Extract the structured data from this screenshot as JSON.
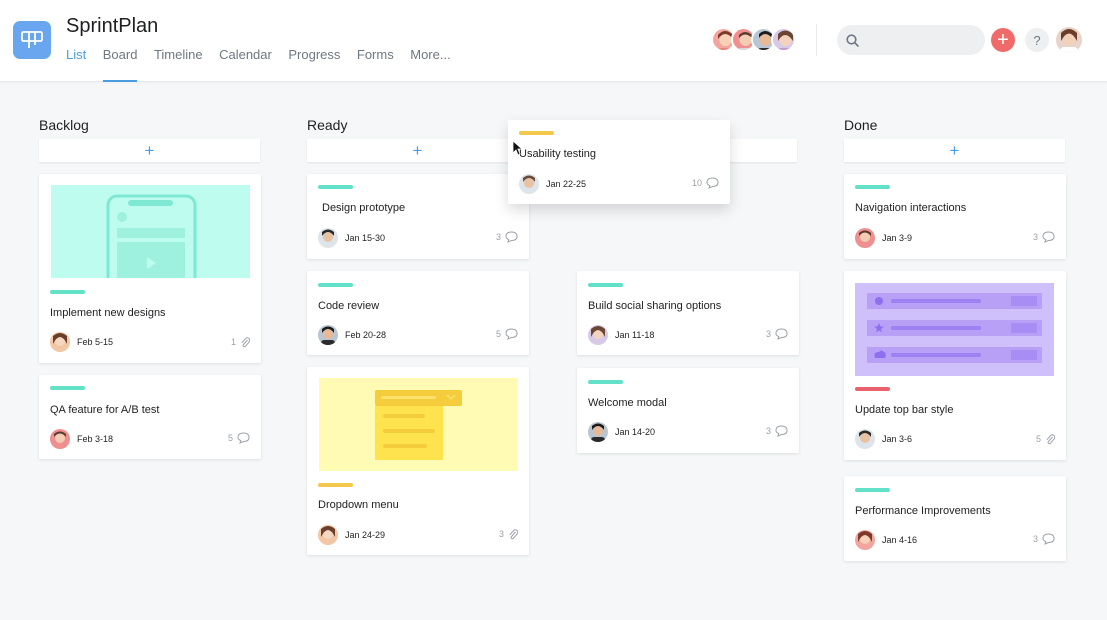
{
  "header": {
    "title": "SprintPlan",
    "tabs": [
      "List",
      "Board",
      "Timeline",
      "Calendar",
      "Progress",
      "Forms",
      "More..."
    ],
    "search_placeholder": "",
    "add_label": "+",
    "help_label": "?"
  },
  "columns": [
    {
      "title": "Backlog",
      "add": "+"
    },
    {
      "title": "Ready",
      "add": "+"
    },
    {
      "title": "",
      "add": ""
    },
    {
      "title": "Done",
      "add": "+"
    }
  ],
  "cards": {
    "implement_new_designs": {
      "title": "Implement new designs",
      "date": "Feb 5-15",
      "count": "1",
      "icon": "paperclip-icon"
    },
    "qa_feature": {
      "title": "QA feature for A/B test",
      "date": "Feb 3-18",
      "count": "5",
      "icon": "comment-icon"
    },
    "design_prototype": {
      "title": "Design prototype",
      "date": "Jan 15-30",
      "count": "3",
      "icon": "comment-icon"
    },
    "code_review": {
      "title": "Code review",
      "date": "Feb 20-28",
      "count": "5",
      "icon": "comment-icon"
    },
    "dropdown_menu": {
      "title": "Dropdown menu",
      "date": "Jan 24-29",
      "count": "3",
      "icon": "paperclip-icon"
    },
    "usability_testing": {
      "title": "Usability testing",
      "date": "Jan 22-25",
      "count": "10",
      "icon": "comment-icon"
    },
    "build_social": {
      "title": "Build social sharing options",
      "date": "Jan 11-18",
      "count": "3",
      "icon": "comment-icon"
    },
    "welcome_modal": {
      "title": "Welcome modal",
      "date": "Jan 14-20",
      "count": "3",
      "icon": "comment-icon"
    },
    "navigation_interactions": {
      "title": "Navigation interactions",
      "date": "Jan 3-9",
      "count": "3",
      "icon": "comment-icon"
    },
    "update_top_bar": {
      "title": "Update top bar style",
      "date": "Jan 3-6",
      "count": "5",
      "icon": "paperclip-icon"
    },
    "performance": {
      "title": "Performance Improvements",
      "date": "Jan 4-16",
      "count": "3",
      "icon": "comment-icon"
    }
  },
  "colors": {
    "accent": "#4a9ddf",
    "tag_green": "#62e0c8",
    "tag_yellow": "#f2c94c",
    "tag_red": "#e8626d",
    "add_button": "#f06a6a",
    "mint_image": "#bdfcef",
    "yellow_image": "#fffbb5",
    "purple_image": "#cfc0fb"
  }
}
